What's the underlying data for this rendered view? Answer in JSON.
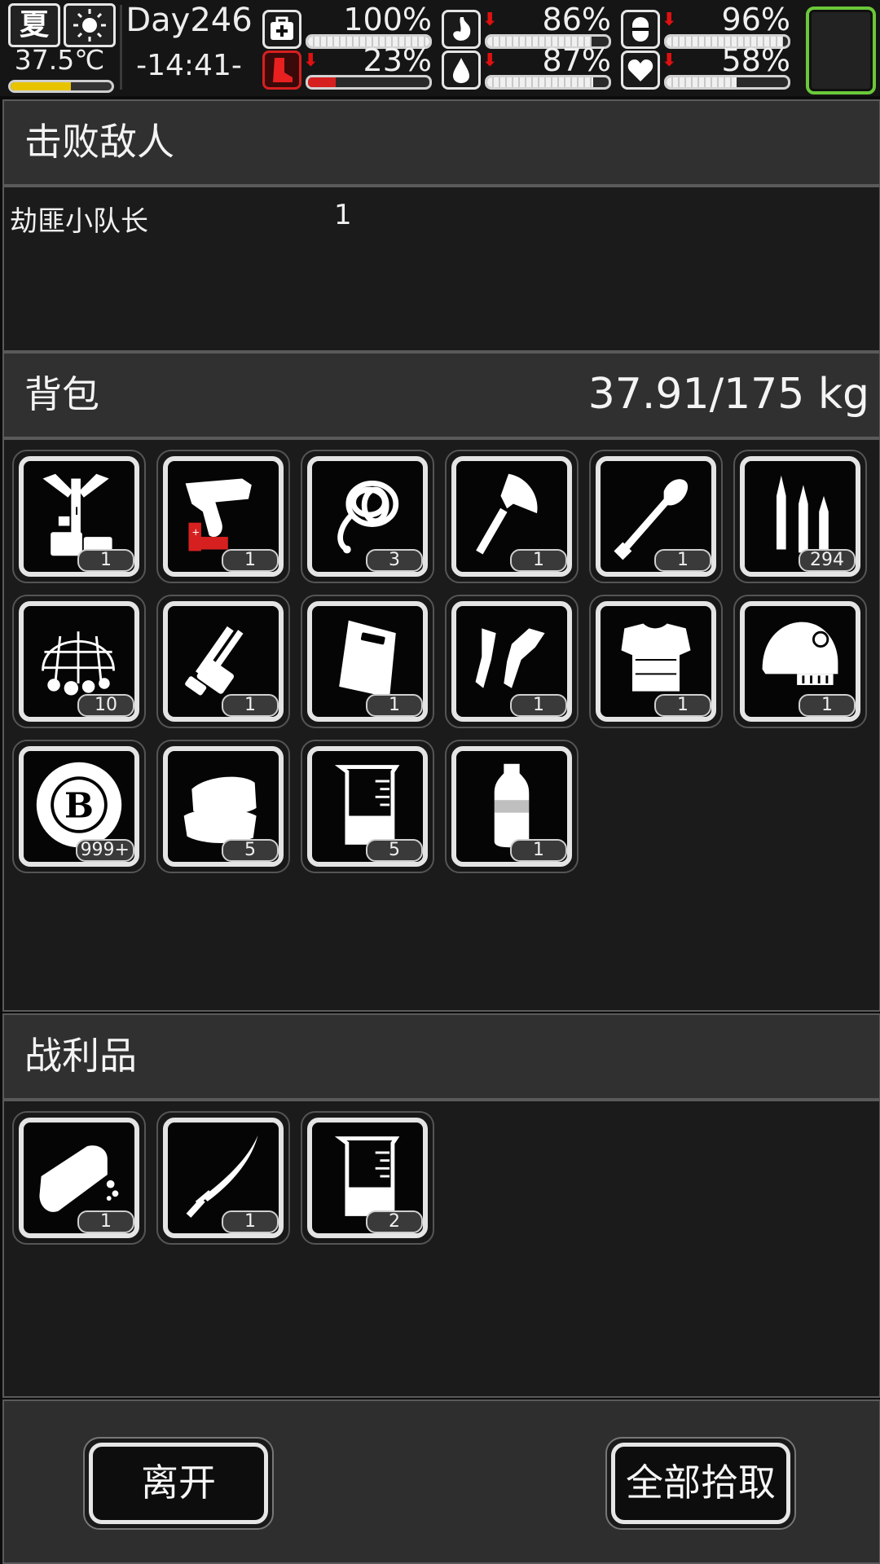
{
  "status": {
    "season": "夏",
    "weather_icon": "sun-icon",
    "temperature": "37.5℃",
    "temperature_level": 0.6,
    "day": "Day246",
    "time": "-14:41-",
    "stats": [
      {
        "name": "health",
        "icon": "medkit-icon",
        "value": "100%",
        "level": 1.0,
        "arrow": false
      },
      {
        "name": "hunger",
        "icon": "stomach-icon",
        "value": "86%",
        "level": 0.86,
        "arrow": true
      },
      {
        "name": "energy",
        "icon": "pill-icon",
        "value": "96%",
        "level": 0.96,
        "arrow": true
      },
      {
        "name": "injury",
        "icon": "boot-icon",
        "value": "23%",
        "level": 0.23,
        "arrow": true
      },
      {
        "name": "thirst",
        "icon": "water-drop-icon",
        "value": "87%",
        "level": 0.87,
        "arrow": true
      },
      {
        "name": "mood",
        "icon": "heart-icon",
        "value": "58%",
        "level": 0.58,
        "arrow": true
      }
    ]
  },
  "defeated": {
    "title": "击败敌人",
    "enemies": [
      {
        "name": "劫匪小队长",
        "count": "1"
      }
    ]
  },
  "backpack": {
    "title": "背包",
    "weight": "37.91/175  kg",
    "items": [
      {
        "icon": "crafting-tools-icon",
        "qty": "1"
      },
      {
        "icon": "flare-gun-icon",
        "qty": "1"
      },
      {
        "icon": "rope-icon",
        "qty": "3"
      },
      {
        "icon": "axe-icon",
        "qty": "1"
      },
      {
        "icon": "shovel-icon",
        "qty": "1"
      },
      {
        "icon": "bullets-icon",
        "qty": "294"
      },
      {
        "icon": "net-icon",
        "qty": "10"
      },
      {
        "icon": "minigun-icon",
        "qty": "1"
      },
      {
        "icon": "riot-shield-icon",
        "qty": "1"
      },
      {
        "icon": "scrap-parts-icon",
        "qty": "1"
      },
      {
        "icon": "body-armor-icon",
        "qty": "1"
      },
      {
        "icon": "helmet-icon",
        "qty": "1"
      },
      {
        "icon": "bitcoin-chip-icon",
        "qty": "999+"
      },
      {
        "icon": "cloth-icon",
        "qty": "5"
      },
      {
        "icon": "beaker-icon",
        "qty": "5"
      },
      {
        "icon": "water-bottle-icon",
        "qty": "1"
      }
    ]
  },
  "loot": {
    "title": "战利品",
    "items": [
      {
        "icon": "bread-icon",
        "qty": "1"
      },
      {
        "icon": "katana-icon",
        "qty": "1"
      },
      {
        "icon": "beaker-icon",
        "qty": "2"
      }
    ]
  },
  "buttons": {
    "leave": "离开",
    "take_all": "全部拾取"
  },
  "colors": {
    "accent_green": "#6bc83a",
    "alert_red": "#d62020",
    "temperature_yellow": "#e8c400"
  }
}
